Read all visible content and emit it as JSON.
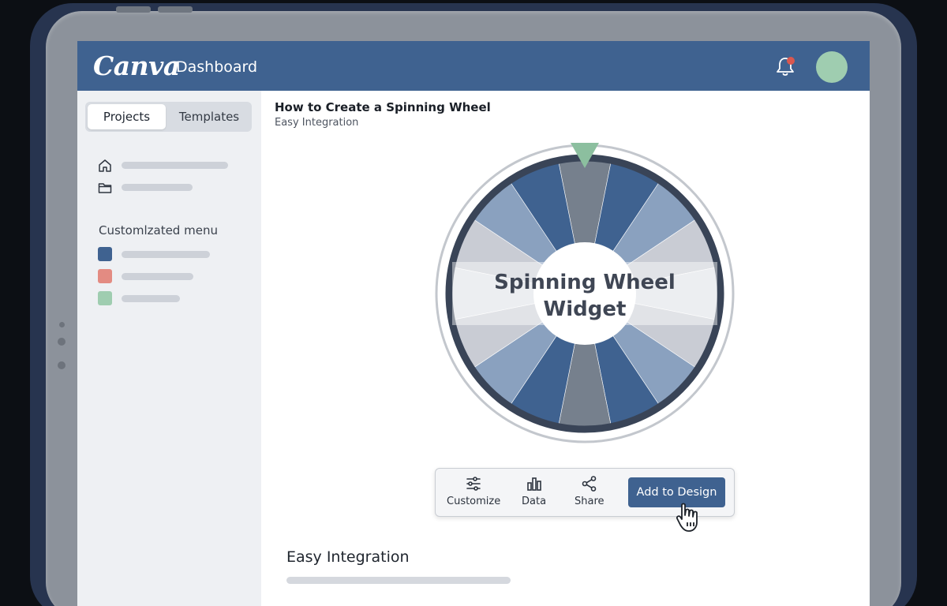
{
  "app": {
    "logo_text": "Canva",
    "title": "Dashboard"
  },
  "topbar": {
    "notification_icon": "bell-icon",
    "has_notification": true,
    "brand_color": "#3f6290"
  },
  "sidebar": {
    "tabs": [
      {
        "label": "Projects",
        "active": true
      },
      {
        "label": "Templates",
        "active": false
      }
    ],
    "nav_items": [
      {
        "icon": "home-icon"
      },
      {
        "icon": "folder-icon"
      }
    ],
    "custom_menu": {
      "heading": "Customlzated menu",
      "items": [
        {
          "color": "#3f6290"
        },
        {
          "color": "#e38b82"
        },
        {
          "color": "#9fcdb0"
        }
      ]
    }
  },
  "main": {
    "title": "How to Create a Spinning Wheel",
    "subtitle": "Easy Integration",
    "wheel": {
      "center_line1": "Spinning Wheel",
      "center_line2": "Widget"
    },
    "toolbar": {
      "customize_label": "Customize",
      "data_label": "Data",
      "share_label": "Share",
      "add_button_label": "Add to Design"
    },
    "section_title": "Easy Integration"
  }
}
